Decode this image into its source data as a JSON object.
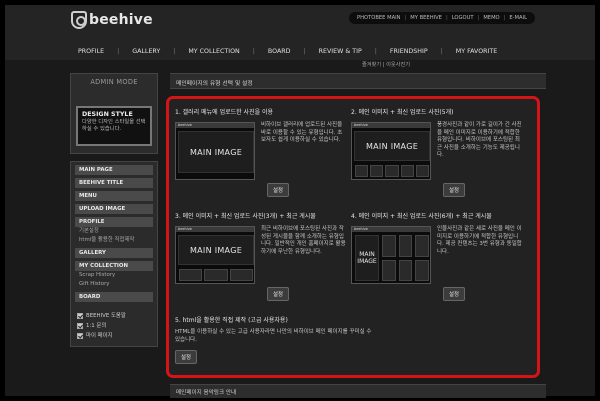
{
  "app": {
    "logo_text": "beehive"
  },
  "top_links": [
    "PHOTOBEE MAIN",
    "MY BEEHIVE",
    "LOGOUT",
    "MEMO",
    "E-MAIL"
  ],
  "nav": [
    "PROFILE",
    "GALLERY",
    "MY COLLECTION",
    "BOARD",
    "REVIEW & TIP",
    "FRIENDSHIP",
    "MY FAVORITE"
  ],
  "subnav": "즐겨찾기 | 이웃사진기",
  "sidebar": {
    "admin_title": "ADMIN MODE",
    "design_style_title": "DESIGN STYLE",
    "design_style_desc": "다양한 디자인 스타일을 선택하실 수 있습니다.",
    "menu": {
      "main_page": "MAIN PAGE",
      "beehive_title": "BEEHIVE TITLE",
      "menu": "MENU",
      "upload_image": "UPLOAD IMAGE",
      "profile": "PROFILE",
      "profile_sub": [
        "기본설정",
        "html을 활용한 직접제작"
      ],
      "gallery": "GALLERY",
      "my_collection": "MY COLLECTION",
      "collection_sub": [
        "Scrap History",
        "Gift History"
      ],
      "board": "BOARD"
    },
    "checks": [
      "BEEHIVE 도움말",
      "1:1 문의",
      "마이 페이지"
    ]
  },
  "main": {
    "page_title": "메인페이지의 유형 선택 및 설정",
    "options": [
      {
        "title": "1. 갤러리 메뉴에 업로드한 사진을 이용",
        "thumb_label": "MAIN IMAGE",
        "desc": "비하이브 갤러리에 업로드된 사진을 바로 이용할 수 있는 유형입니다. 초보자도 쉽게 이용하실 수 있습니다.",
        "button": "설정"
      },
      {
        "title": "2. 메인 이미지 + 최신 업로드 사진(5개)",
        "thumb_label": "MAIN IMAGE",
        "desc": "풍경사진과 같이 가로 길이가 긴 사진을 메인 이미지로 이용하기에 적합한 유형입니다. 비하이브에 포스팅된 최근 사진을 소개하는 기능도 제공됩니다.",
        "button": "설정"
      },
      {
        "title": "3. 메인 이미지 + 최신 업로드 사진(3개) + 최근 게시물",
        "thumb_label": "MAIN IMAGE",
        "desc": "최근 비하이브에 포스팅된 사진과 작성된 게시물을 함께 소개하는 유형입니다. 일반적인 개인 홈페이지로 활용하기에 무난한 유형입니다.",
        "button": "설정"
      },
      {
        "title": "4. 메인 이미지 + 최신 업로드 사진(6개) + 최근 게시물",
        "thumb_label": "MAIN IMAGE",
        "desc": "인물사진과 같은 세로 사진을 메인 이미지로 이용하기에 적합한 유형입니다. 제공 컨텐츠는 3번 유형과 동일합니다.",
        "button": "설정"
      }
    ],
    "option5": {
      "title": "5. html을 활용한 직접 제작 (고급 사용자용)",
      "desc": "HTML을 이용하실 수 있는 고급 사용자라면 나만의 비하이브 메인 페이지를 꾸미실 수 있습니다.",
      "button": "설정"
    },
    "footer_title": "메인페이지 음악링크 안내"
  }
}
